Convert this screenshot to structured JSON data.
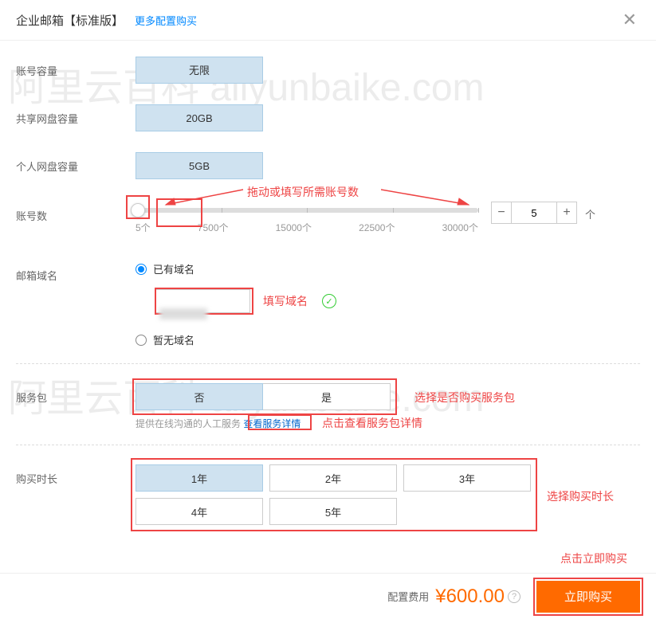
{
  "header": {
    "title": "企业邮箱【标准版】",
    "more_link": "更多配置购买"
  },
  "rows": {
    "account_capacity": {
      "label": "账号容量",
      "value": "无限"
    },
    "shared_disk": {
      "label": "共享网盘容量",
      "value": "20GB"
    },
    "personal_disk": {
      "label": "个人网盘容量",
      "value": "5GB"
    },
    "account_count": {
      "label": "账号数",
      "ticks": [
        "5个",
        "7500个",
        "15000个",
        "22500个",
        "30000个"
      ],
      "value": "5",
      "unit": "个"
    },
    "domain": {
      "label": "邮箱域名",
      "opt_has": "已有域名",
      "opt_none": "暂无域名"
    },
    "service_pack": {
      "label": "服务包",
      "no": "否",
      "yes": "是",
      "desc_prefix": "提供在线沟通的人工服务",
      "link": "查看服务详情"
    },
    "duration": {
      "label": "购买时长",
      "options": [
        "1年",
        "2年",
        "3年",
        "4年",
        "5年"
      ]
    }
  },
  "annotations": {
    "drag_hint": "拖动或填写所需账号数",
    "domain_hint": "填写域名",
    "svc_sel_hint": "选择是否购买服务包",
    "svc_link_hint": "点击查看服务包详情",
    "duration_hint": "选择购买时长",
    "buy_hint": "点击立即购买"
  },
  "footer": {
    "fee_label": "配置费用",
    "price": "¥600.00",
    "buy_label": "立即购买"
  }
}
